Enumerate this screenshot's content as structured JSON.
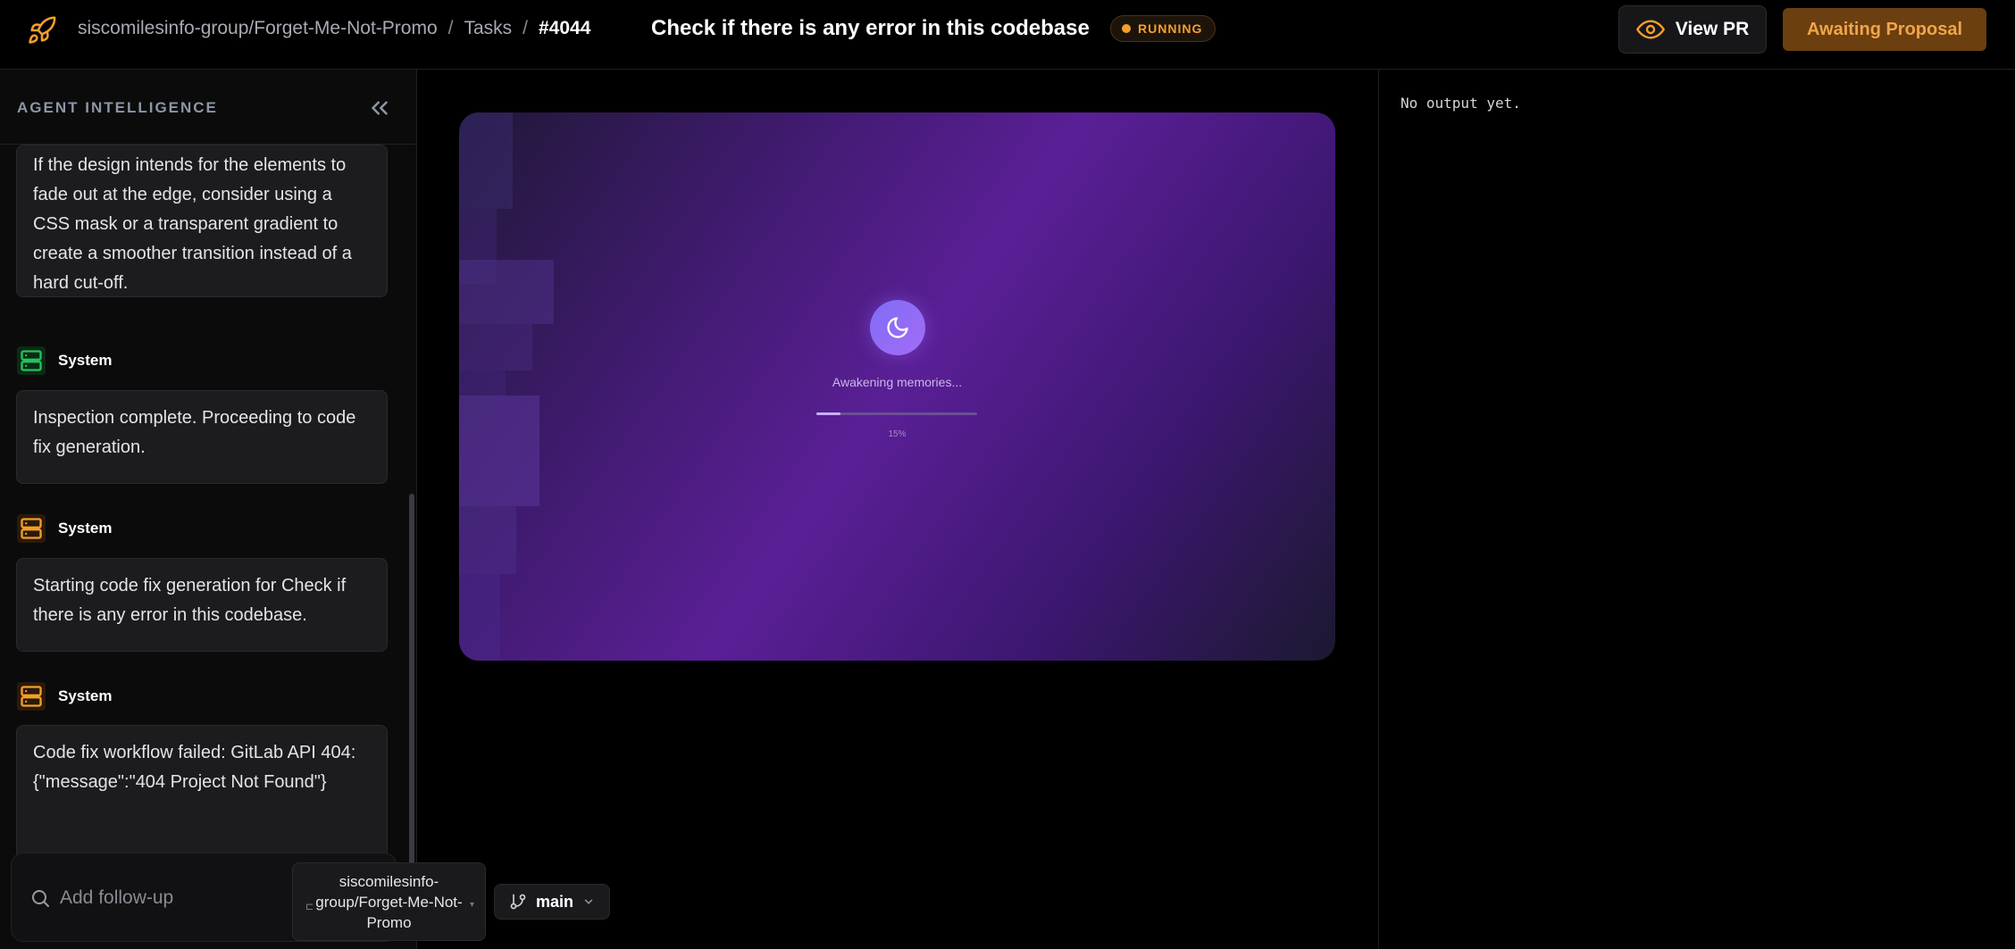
{
  "header": {
    "repo": "siscomilesinfo-group/Forget-Me-Not-Promo",
    "separator": "/",
    "section": "Tasks",
    "task_id": "#4044",
    "title": "Check if there is any error in this codebase",
    "status": "RUNNING",
    "view_pr_label": "View PR",
    "awaiting_label": "Awaiting Proposal"
  },
  "sidebar": {
    "title": "AGENT INTELLIGENCE",
    "messages": [
      {
        "text": "If the design intends for the elements to fade out at the edge, consider using a CSS mask or a transparent gradient to create a smoother transition instead of a hard cut-off."
      },
      {
        "sender": "System",
        "icon": "server-icon",
        "color": "#22c55e",
        "text": "Inspection complete. Proceeding to code fix generation."
      },
      {
        "sender": "System",
        "icon": "server-icon",
        "color": "#f59e2b",
        "text": "Starting code fix generation for Check if there is any error in this codebase."
      },
      {
        "sender": "System",
        "icon": "server-icon",
        "color": "#f59e2b",
        "text": "Code fix workflow failed: GitLab API 404: {\"message\":\"404 Project Not Found\"}"
      }
    ]
  },
  "composer": {
    "placeholder": "Add follow-up",
    "repo": "siscomilesinfo-group/Forget-Me-Not-Promo",
    "branch": "main"
  },
  "preview": {
    "loading_text": "Awakening memories...",
    "progress_label": "15%",
    "progress": 0.15
  },
  "output": {
    "text": "No output yet."
  },
  "colors": {
    "accent": "#f59e2b",
    "success": "#22c55e",
    "awaiting_bg": "#6b3f0f"
  }
}
